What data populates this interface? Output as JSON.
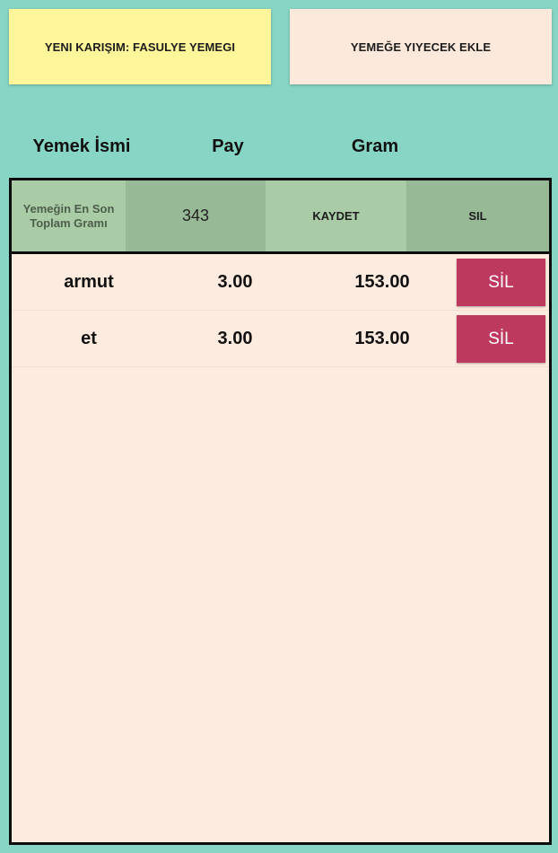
{
  "header": {
    "mix_button": "YENI KARIŞIM: FASULYE YEMEGI",
    "add_food_button": "YEMEĞE YIYECEK EKLE"
  },
  "columns": {
    "name": "Yemek İsmi",
    "portion": "Pay",
    "gram": "Gram"
  },
  "summary": {
    "label": "Yemeğin En Son Toplam Gramı",
    "value": "343",
    "save_button": "KAYDET",
    "delete_button": "SIL"
  },
  "items": [
    {
      "name": "armut",
      "portion": "3.00",
      "gram": "153.00",
      "delete_label": "SİL"
    },
    {
      "name": "et",
      "portion": "3.00",
      "gram": "153.00",
      "delete_label": "SİL"
    }
  ],
  "colors": {
    "background": "#87d5c5",
    "mix_button": "#fff69a",
    "add_button": "#fde8dc",
    "delete_button": "#bd3a5e",
    "summary_light": "#a9cba6",
    "summary_dark": "#98b996"
  }
}
